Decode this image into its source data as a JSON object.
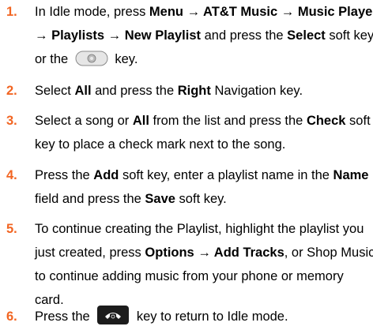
{
  "steps": [
    {
      "number": "1.",
      "lines": [
        [
          "In Idle mode, press ",
          {
            "b": "Menu → AT&T Music → Music Player"
          }
        ],
        [
          {
            "b": "→ Playlists → New Playlist"
          },
          " and press the ",
          {
            "b": "Select"
          },
          " soft key"
        ],
        [
          "or the ",
          {
            "icon": "select-key"
          },
          " key."
        ]
      ]
    },
    {
      "number": "2.",
      "lines": [
        [
          "Select ",
          {
            "b": "All"
          },
          " and press the ",
          {
            "b": "Right"
          },
          " Navigation key."
        ]
      ]
    },
    {
      "number": "3.",
      "lines": [
        [
          "Select a song or ",
          {
            "b": "All"
          },
          " from the list and press the ",
          {
            "b": "Check"
          },
          " soft"
        ],
        [
          "key to place a check mark next to the song."
        ]
      ]
    },
    {
      "number": "4.",
      "lines": [
        [
          "Press the ",
          {
            "b": "Add"
          },
          " soft key, enter a playlist name in the ",
          {
            "b": "Name"
          }
        ],
        [
          "field and press the ",
          {
            "b": "Save"
          },
          " soft key."
        ]
      ]
    },
    {
      "number": "5.",
      "lines": [
        [
          "To continue creating the Playlist, highlight the playlist you"
        ],
        [
          "just created, press ",
          {
            "b": "Options → Add Tracks"
          },
          ", or Shop Music"
        ],
        [
          "to continue adding music from your phone or memory"
        ],
        [
          "card."
        ]
      ]
    },
    {
      "number": "6.",
      "lines": [
        [
          "Press the ",
          {
            "icon": "end-key"
          },
          " key to return to Idle mode."
        ]
      ]
    }
  ],
  "accent_color": "#f26522"
}
